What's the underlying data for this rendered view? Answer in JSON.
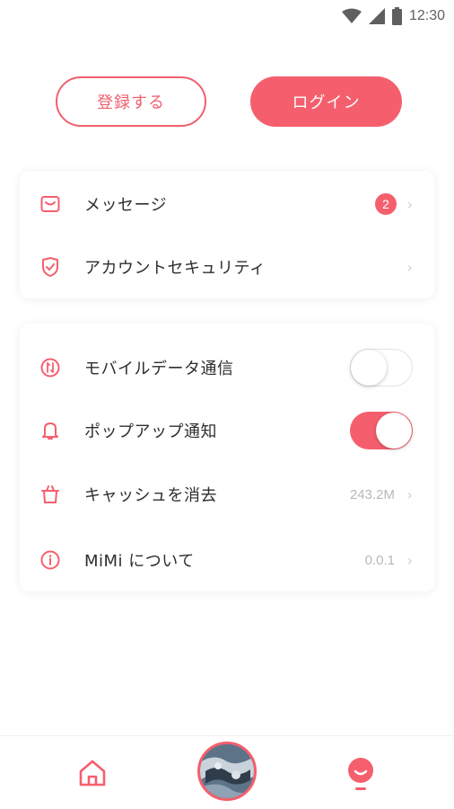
{
  "status_bar": {
    "time": "12:30",
    "icons": [
      "wifi-icon",
      "cell-signal-icon",
      "battery-icon"
    ]
  },
  "auth": {
    "register_label": "登録する",
    "login_label": "ログイン"
  },
  "menu_account": [
    {
      "icon": "mail-icon",
      "label": "メッセージ",
      "badge": "2"
    },
    {
      "icon": "shield-icon",
      "label": "アカウントセキュリティ"
    }
  ],
  "menu_settings": [
    {
      "icon": "data-icon",
      "label": "モバイルデータ通信",
      "toggle": "off"
    },
    {
      "icon": "bell-icon",
      "label": "ポップアップ通知",
      "toggle": "on"
    },
    {
      "icon": "trash-icon",
      "label": "キャッシュを消去",
      "value": "243.2M"
    },
    {
      "icon": "info-icon",
      "label": "MiMi について",
      "value": "0.0.1"
    }
  ],
  "bottom_nav": {
    "items": [
      "home-icon",
      "avatar",
      "profile-icon"
    ],
    "active": "profile-icon"
  },
  "colors": {
    "accent": "#f55f6d",
    "text": "#2e2e2e",
    "muted": "#b8b8b8"
  }
}
